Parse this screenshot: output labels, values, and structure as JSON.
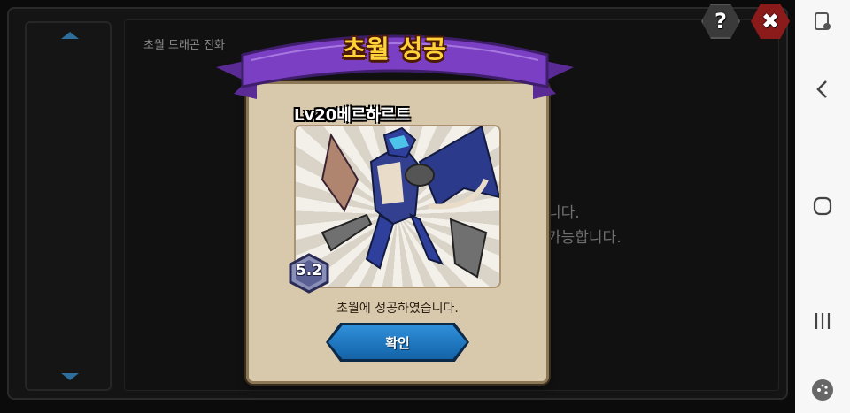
{
  "background": {
    "heading": "초월 드래곤 진화",
    "line1": "니다.",
    "line2": "가능합니다."
  },
  "buttons": {
    "help": "?",
    "close": "✖"
  },
  "dialog": {
    "title": "초월 성공",
    "character_name": "Lv20베르하르트",
    "grade": "5.2",
    "message": "초월에 성공하였습니다.",
    "confirm_label": "확인"
  },
  "colors": {
    "ribbon": "#7b3fc4",
    "title_text": "#ffd23a",
    "confirm_button": "#1f7cc6",
    "close_button": "#8b1a1a",
    "dialog_bg": "#d8c9ad"
  },
  "navbar": {
    "icons": [
      "screenshot-icon",
      "back-icon",
      "home-icon",
      "recent-apps-icon",
      "game-launcher-icon"
    ]
  }
}
